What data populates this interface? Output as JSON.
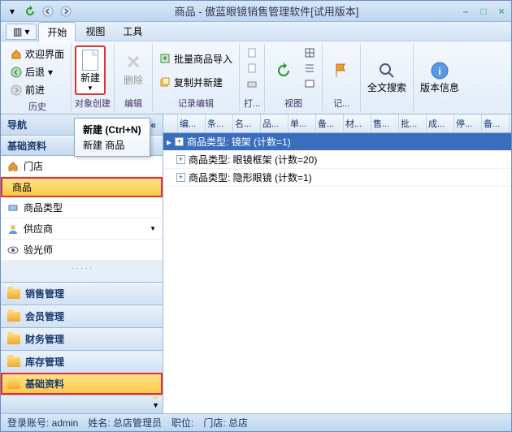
{
  "title": "商品 - 傲蓝眼镜销售管理软件[试用版本]",
  "menubar": {
    "app": "▾",
    "start": "开始",
    "view": "视图",
    "tools": "工具"
  },
  "ribbon": {
    "history": {
      "welcome": "欢迎界面",
      "back": "后退",
      "forward": "前进",
      "label": "历史"
    },
    "create": {
      "new": "新建",
      "label": "对象创建"
    },
    "edit": {
      "delete": "删除",
      "label": "编辑"
    },
    "record": {
      "import": "批量商品导入",
      "copy": "复制并新建",
      "label": "记录编辑"
    },
    "print": {
      "label": "打..."
    },
    "viewg": {
      "label": "视图"
    },
    "mark": {
      "label": "记..."
    },
    "search": {
      "btn": "全文搜索"
    },
    "version": {
      "btn": "版本信息"
    }
  },
  "tooltip": {
    "title": "新建 (Ctrl+N)",
    "body": "新建 商品"
  },
  "nav": {
    "title": "导航",
    "header": "基础资料",
    "items": [
      {
        "icon": "home",
        "label": "门店"
      },
      {
        "icon": "folder",
        "label": "商品",
        "sel": true
      },
      {
        "icon": "tag",
        "label": "商品类型"
      },
      {
        "icon": "user",
        "label": "供应商"
      },
      {
        "icon": "eye",
        "label": "验光师"
      }
    ],
    "sections": [
      {
        "label": "销售管理"
      },
      {
        "label": "会员管理"
      },
      {
        "label": "财务管理"
      },
      {
        "label": "库存管理"
      },
      {
        "label": "基础资料",
        "active": true
      }
    ]
  },
  "grid": {
    "cols": [
      "",
      "编...",
      "条...",
      "名...",
      "品...",
      "单...",
      "备...",
      "材...",
      "售...",
      "批...",
      "成...",
      "停...",
      "备..."
    ],
    "rows": [
      {
        "label": "商品类型: 镜架  (计数=1)",
        "sel": true
      },
      {
        "label": "商品类型: 眼镜框架  (计数=20)"
      },
      {
        "label": "商品类型: 隐形眼镜  (计数=1)"
      }
    ]
  },
  "status": {
    "account": "登录账号: admin",
    "name": "姓名: 总店管理员",
    "role": "职位:",
    "store": "门店: 总店"
  }
}
